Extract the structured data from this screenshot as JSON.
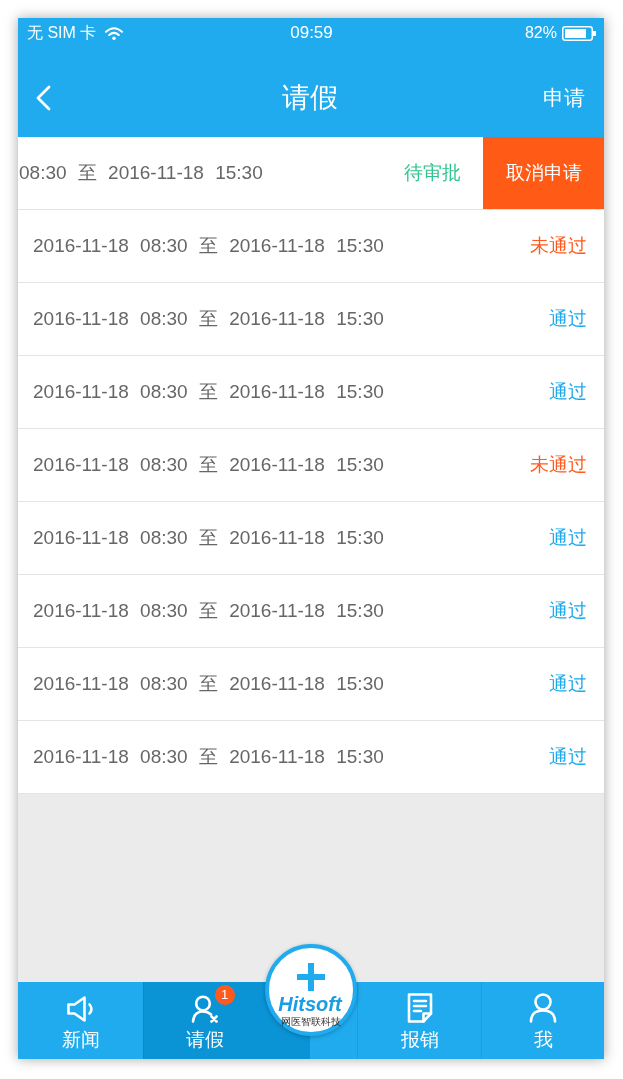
{
  "status_bar": {
    "carrier": "无 SIM 卡",
    "time": "09:59",
    "battery": "82%"
  },
  "nav_bar": {
    "title": "请假",
    "action": "申请"
  },
  "rows": [
    {
      "period": "08:30 至 2016-11-18 15:30",
      "status": "待审批",
      "color": "#2fc48c",
      "swiped": true,
      "action": "取消申请"
    },
    {
      "period": "2016-11-18 08:30 至 2016-11-18 15:30",
      "status": "未通过",
      "color": "#ff5a1e",
      "swiped": false
    },
    {
      "period": "2016-11-18 08:30 至 2016-11-18 15:30",
      "status": "通过",
      "color": "#1ea9ec",
      "swiped": false
    },
    {
      "period": "2016-11-18 08:30 至 2016-11-18 15:30",
      "status": "通过",
      "color": "#1ea9ec",
      "swiped": false
    },
    {
      "period": "2016-11-18 08:30 至 2016-11-18 15:30",
      "status": "未通过",
      "color": "#ff5a1e",
      "swiped": false
    },
    {
      "period": "2016-11-18 08:30 至 2016-11-18 15:30",
      "status": "通过",
      "color": "#1ea9ec",
      "swiped": false
    },
    {
      "period": "2016-11-18 08:30 至 2016-11-18 15:30",
      "status": "通过",
      "color": "#1ea9ec",
      "swiped": false
    },
    {
      "period": "2016-11-18 08:30 至 2016-11-18 15:30",
      "status": "通过",
      "color": "#1ea9ec",
      "swiped": false
    },
    {
      "period": "2016-11-18 08:30 至 2016-11-18 15:30",
      "status": "通过",
      "color": "#1ea9ec",
      "swiped": false
    }
  ],
  "tab_bar": {
    "tabs": [
      {
        "label": "新闻",
        "selected": false
      },
      {
        "label": "请假",
        "selected": true,
        "badge": "1"
      },
      {
        "label": "报销",
        "selected": false
      },
      {
        "label": "我",
        "selected": false
      }
    ],
    "center_button": {
      "logo": "Hitsoft",
      "subtitle": "网医智联科技"
    }
  }
}
